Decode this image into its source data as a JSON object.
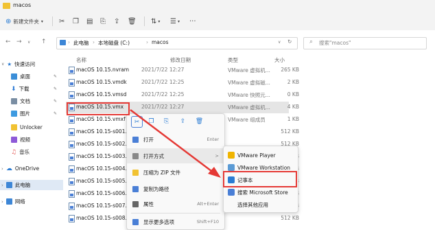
{
  "window": {
    "title": "macos"
  },
  "toolbar": {
    "new_label": "新建文件夹",
    "icons": [
      "cut-icon",
      "copy-icon",
      "paste-icon",
      "rename-icon",
      "share-icon",
      "delete-icon",
      "sort-icon",
      "view-icon",
      "more-icon"
    ]
  },
  "address": {
    "crumbs": [
      "此电脑",
      "本地磁盘 (C:)",
      "macos"
    ],
    "search_placeholder": "搜索\"macos\""
  },
  "sidebar": {
    "items": [
      {
        "label": "快速访问",
        "icon": "star-icon",
        "color": "#2b7cd3"
      },
      {
        "label": "桌面",
        "icon": "desktop-icon",
        "color": "#3b8ed8"
      },
      {
        "label": "下载",
        "icon": "download-icon",
        "color": "#2e7bd6"
      },
      {
        "label": "文档",
        "icon": "document-icon",
        "color": "#7a8ea3"
      },
      {
        "label": "图片",
        "icon": "picture-icon",
        "color": "#3d9ae0"
      },
      {
        "label": "Unlocker",
        "icon": "folder-icon",
        "color": "#f1c232"
      },
      {
        "label": "视频",
        "icon": "video-icon",
        "color": "#8e5ad8"
      },
      {
        "label": "音乐",
        "icon": "music-icon",
        "color": "#e35b57"
      },
      {
        "label": "OneDrive",
        "icon": "cloud-icon",
        "color": "#2b7cd3"
      },
      {
        "label": "此电脑",
        "icon": "computer-icon",
        "color": "#3d86d6"
      },
      {
        "label": "网络",
        "icon": "network-icon",
        "color": "#3d86d6"
      }
    ]
  },
  "columns": {
    "name": "名称",
    "date": "修改日期",
    "type": "类型",
    "size": "大小"
  },
  "files": [
    {
      "name": "macOS 10.15.nvram",
      "date": "2021/7/22 12:27",
      "type": "VMware 虚拟机...",
      "size": "265 KB"
    },
    {
      "name": "macOS 10.15.vmdk",
      "date": "2021/7/22 12:25",
      "type": "VMware 虚拟磁...",
      "size": "2 KB"
    },
    {
      "name": "macOS 10.15.vmsd",
      "date": "2021/7/22 12:25",
      "type": "VMware 快照元...",
      "size": "0 KB"
    },
    {
      "name": "macOS 10.15.vmx",
      "date": "2021/7/22 12:27",
      "type": "VMware 虚拟机...",
      "size": "4 KB"
    },
    {
      "name": "macOS 10.15.vmxf",
      "date": "",
      "type": "VMware 组成员",
      "size": "1 KB"
    },
    {
      "name": "macOS 10.15-s001.vm",
      "date": "",
      "type": "",
      "size": "512 KB"
    },
    {
      "name": "macOS 10.15-s002.vm",
      "date": "",
      "type": "",
      "size": "512 KB"
    },
    {
      "name": "macOS 10.15-s003.vm",
      "date": "",
      "type": "",
      "size": "512 KB"
    },
    {
      "name": "macOS 10.15-s004.vm",
      "date": "",
      "type": "",
      "size": "512 KB"
    },
    {
      "name": "macOS 10.15-s005.vm",
      "date": "",
      "type": "",
      "size": "512 KB"
    },
    {
      "name": "macOS 10.15-s006.vm",
      "date": "",
      "type": "",
      "size": "512 KB"
    },
    {
      "name": "macOS 10.15-s007.vm",
      "date": "",
      "type": "",
      "size": "512 KB"
    },
    {
      "name": "macOS 10.15-s008.vm",
      "date": "",
      "type": "",
      "size": "512 KB"
    }
  ],
  "context_menu": {
    "icons": [
      "cut-icon",
      "copy-icon",
      "rename-icon",
      "share-icon",
      "delete-icon"
    ],
    "items": [
      {
        "label": "打开",
        "shortcut": "Enter"
      },
      {
        "label": "打开方式",
        "shortcut": ">"
      },
      {
        "label": "压缩为 ZIP 文件",
        "shortcut": ""
      },
      {
        "label": "复制为路径",
        "shortcut": ""
      },
      {
        "label": "属性",
        "shortcut": "Alt+Enter"
      },
      {
        "label": "显示更多选项",
        "shortcut": "Shift+F10"
      }
    ]
  },
  "submenu": {
    "items": [
      {
        "label": "VMware Player",
        "color": "#f0b400"
      },
      {
        "label": "VMware Workstation",
        "color": "#5b9bd5"
      },
      {
        "label": "记事本",
        "color": "#2b7cd3"
      },
      {
        "label": "搜索 Microsoft Store",
        "color": "#4a7fd6"
      },
      {
        "label": "选择其他应用",
        "color": ""
      }
    ]
  },
  "colors": {
    "highlight": "#e53935",
    "accent": "#2b7cd3"
  }
}
